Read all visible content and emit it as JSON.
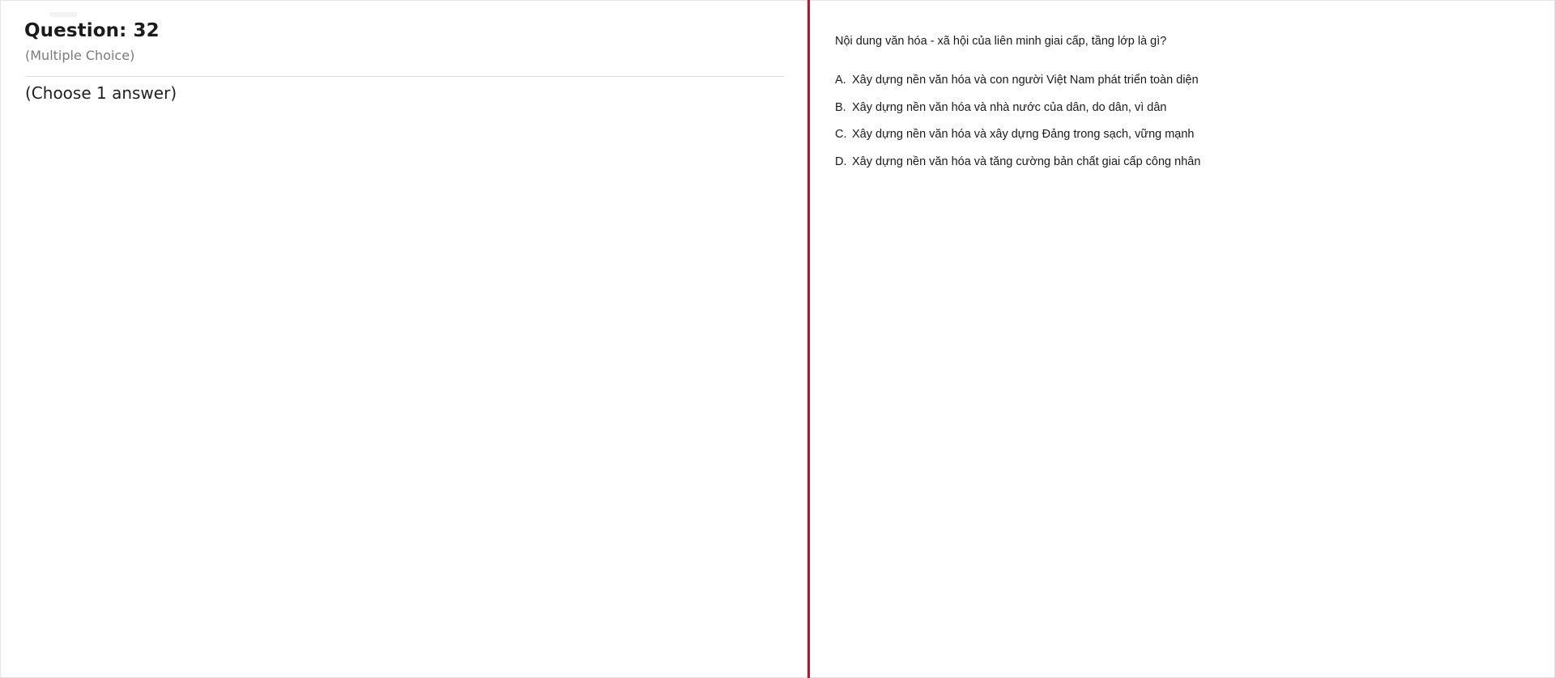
{
  "question": {
    "title": "Question: 32",
    "type": "(Multiple Choice)",
    "instruction": "(Choose 1 answer)"
  },
  "prompt": "Nội dung văn hóa - xã hội của liên minh giai cấp, tầng lớp là gì?",
  "options": [
    {
      "letter": "A.",
      "text": "Xây dựng nền văn hóa và con người Việt Nam phát triển toàn diện"
    },
    {
      "letter": "B.",
      "text": "Xây dựng nền văn hóa và nhà nước của dân, do dân, vì dân"
    },
    {
      "letter": "C.",
      "text": "Xây dựng nền văn hóa và xây dựng Đảng trong sạch, vững mạnh"
    },
    {
      "letter": "D.",
      "text": "Xây dựng nền văn hóa và tăng cường bản chất giai cấp công nhân"
    }
  ],
  "colors": {
    "divider": "#c8102e",
    "subtitle": "#7b7b7b",
    "rule": "#dddddd"
  }
}
